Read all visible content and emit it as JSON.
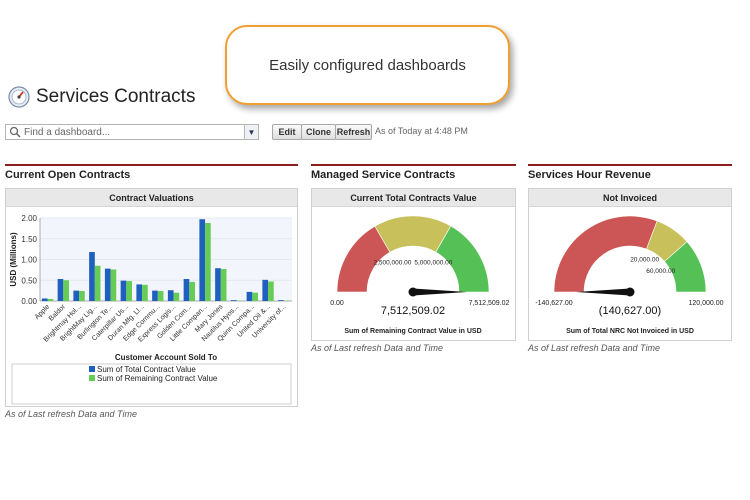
{
  "callout": {
    "text": "Easily configured dashboards"
  },
  "header": {
    "title": "Services Contracts",
    "icon": "speedometer-icon"
  },
  "toolbar": {
    "search_placeholder": "Find a dashboard...",
    "edit_label": "Edit",
    "clone_label": "Clone",
    "refresh_label": "Refresh",
    "as_of": "As of Today at 4:48 PM"
  },
  "columns": [
    {
      "title": "Current Open Contracts",
      "panel_title": "Contract Valuations",
      "footnote": "As of Last refresh Data and Time"
    },
    {
      "title": "Managed Service Contracts",
      "panel_title": "Current Total Contracts Value",
      "footnote": "As of Last refresh Data and Time"
    },
    {
      "title": "Services Hour Revenue",
      "panel_title": "Not Invoiced",
      "footnote": "As of Last refresh Data and Time"
    }
  ],
  "chart_data": [
    {
      "type": "bar",
      "title": "Contract Valuations",
      "xlabel": "Customer Account Sold To",
      "ylabel": "USD (Millions)",
      "ylim": [
        0,
        2.0
      ],
      "yticks": [
        "0.00",
        "0.50",
        "1.00",
        "1.50",
        "2.00"
      ],
      "grid": true,
      "legend": "bottom",
      "categories": [
        "Apple",
        "Baldor",
        "Brightmay Hol...",
        "BrightMay Lig...",
        "Burlington Te...",
        "Caterpillar Us...",
        "Duran Mfg. Ll...",
        "Edge Commu...",
        "Express Logis...",
        "Golden Com...",
        "Little Compan...",
        "Mary Jones",
        "Nautilus Hyos...",
        "Quinn Compa...",
        "United Oil &...",
        "University of..."
      ],
      "series": [
        {
          "name": "Sum of Total Contract Value",
          "color": "#1f5fbf",
          "values": [
            0.06,
            0.53,
            0.25,
            1.18,
            0.78,
            0.49,
            0.4,
            0.25,
            0.26,
            0.53,
            1.97,
            0.79,
            0.02,
            0.22,
            0.51,
            0.02
          ]
        },
        {
          "name": "Sum of Remaining Contract Value",
          "color": "#66cc55",
          "values": [
            0.05,
            0.5,
            0.24,
            0.85,
            0.76,
            0.48,
            0.39,
            0.24,
            0.2,
            0.46,
            1.88,
            0.77,
            0.01,
            0.2,
            0.47,
            0.01
          ]
        }
      ]
    },
    {
      "type": "gauge",
      "title": "Current Total Contracts Value",
      "min_label": "0.00",
      "max_label": "7,512,509.02",
      "bands": [
        "2,500,000.00",
        "5,000,000.00"
      ],
      "value_label": "7,512,509.02",
      "min": 0,
      "max": 7512509.02,
      "value": 7512509.02,
      "footer": "Sum of Remaining Contract Value in USD",
      "colors": [
        "#cc5555",
        "#c8c05a",
        "#55c055"
      ]
    },
    {
      "type": "gauge",
      "title": "Not Invoiced",
      "min_label": "-140,627.00",
      "max_label": "120,000.00",
      "bands": [
        "20,000.00",
        "60,000.00"
      ],
      "value_label": "(140,627.00)",
      "min": -140627,
      "max": 120000,
      "value": -140627,
      "footer": "Sum of Total NRC Not Invoiced in USD",
      "colors": [
        "#cc5555",
        "#c8c05a",
        "#55c055"
      ]
    }
  ]
}
